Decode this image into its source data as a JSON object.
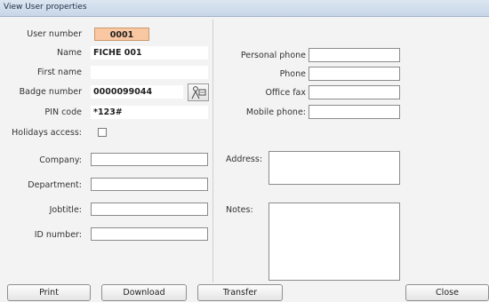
{
  "window": {
    "title": "View User properties"
  },
  "left": {
    "user_number_label": "User number",
    "user_number_value": "0001",
    "name_label": "Name",
    "name_value": "FICHE 001",
    "first_name_label": "First name",
    "first_name_value": "",
    "badge_label": "Badge number",
    "badge_value": "0000099044",
    "pin_label": "PIN code",
    "pin_value": "*123#",
    "holidays_label": "Holidays access:",
    "company_label": "Company:",
    "department_label": "Department:",
    "jobtitle_label": "Jobtitle:",
    "id_label": "ID number:"
  },
  "right": {
    "personal_phone_label": "Personal phone",
    "phone_label": "Phone",
    "office_fax_label": "Office fax",
    "mobile_label": "Mobile phone:",
    "address_label": "Address:",
    "notes_label": "Notes:"
  },
  "buttons": {
    "print": "Print",
    "download": "Download",
    "transfer": "Transfer",
    "close": "Close"
  },
  "icons": {
    "badge_reader": "badge-reader-icon"
  }
}
